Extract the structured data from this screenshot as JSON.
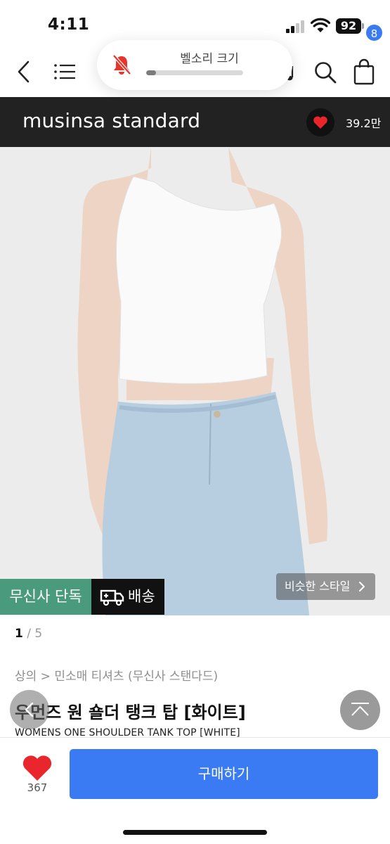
{
  "status_bar": {
    "time": "4:11",
    "battery_level": "92"
  },
  "nav": {
    "cart_count": "8"
  },
  "volume_hud": {
    "label": "벨소리 크기",
    "level_percent": 10
  },
  "brand": {
    "name": "musinsa standard",
    "like_count": "39.2만",
    "like_color": "#e8262b"
  },
  "badges": {
    "exclusive": "무신사 단독",
    "shipping": "배송",
    "exclusive_color": "#4a9a7e"
  },
  "similar_style": {
    "label": "비슷한 스타일"
  },
  "pager": {
    "current": "1",
    "separator": " / ",
    "total": "5"
  },
  "product": {
    "category_path": "상의 > 민소매 티셔츠 (무신사 스탠다드)",
    "title": "우먼즈 원 숄더 탱크 탑 [화이트]",
    "subtitle": "WOMENS ONE SHOULDER TANK TOP [WHITE]"
  },
  "bottom_bar": {
    "like_count": "367",
    "buy_label": "구매하기",
    "buy_color": "#3a7af2"
  }
}
